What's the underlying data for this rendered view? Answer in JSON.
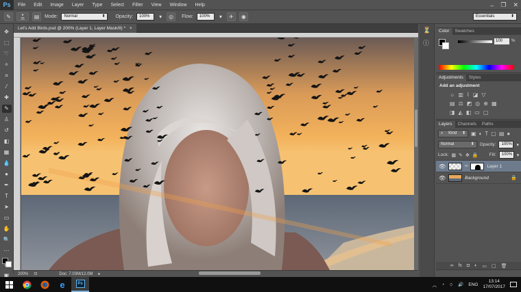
{
  "app": {
    "logo": "Ps"
  },
  "menu": [
    "File",
    "Edit",
    "Image",
    "Layer",
    "Type",
    "Select",
    "Filter",
    "View",
    "Window",
    "Help"
  ],
  "options_bar": {
    "brush_size": "25",
    "mode_label": "Mode:",
    "mode_value": "Normal",
    "opacity_label": "Opacity:",
    "opacity_value": "100%",
    "flow_label": "Flow:",
    "flow_value": "100%",
    "workspace": "Essentials"
  },
  "document": {
    "tab_title": "Let's Add Birds.psd @ 200% (Layer 1, Layer Mask/8) *",
    "zoom": "200%",
    "doc_info": "Doc: 7.03M/12.0M"
  },
  "color_panel": {
    "tabs": [
      "Color",
      "Swatches"
    ],
    "value": "100",
    "unit": "%"
  },
  "adjustments_panel": {
    "tabs": [
      "Adjustments",
      "Styles"
    ],
    "heading": "Add an adjustment"
  },
  "layers_panel": {
    "tabs": [
      "Layers",
      "Channels",
      "Paths"
    ],
    "filter_kind": "Kind",
    "blend_mode": "Normal",
    "opacity_label": "Opacity:",
    "opacity_value": "100%",
    "lock_label": "Lock:",
    "fill_label": "Fill:",
    "fill_value": "100%",
    "layers": [
      {
        "name": "Layer 1",
        "selected": true
      },
      {
        "name": "Background",
        "selected": false
      }
    ]
  },
  "taskbar": {
    "language": "ENG",
    "time": "13:14",
    "date": "17/07/2017"
  },
  "colors": {
    "accent": "#5fb8f5",
    "panel_bg": "#535353",
    "selected_layer": "#6d7b8d"
  }
}
